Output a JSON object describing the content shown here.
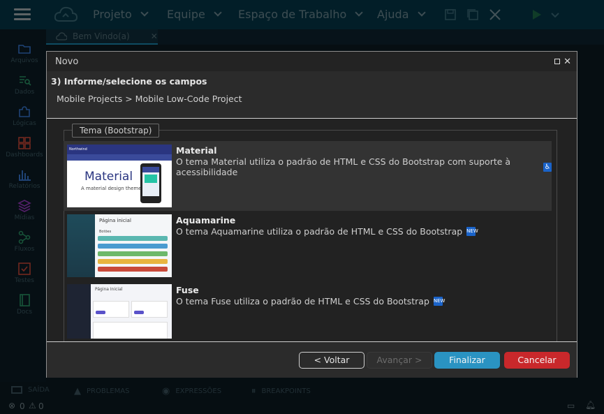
{
  "app": {
    "menu": [
      "Projeto",
      "Equipe",
      "Espaço de Trabalho",
      "Ajuda"
    ],
    "tab_label": "Bem Vindo(a)"
  },
  "sidebar": [
    {
      "label": "Arquivos",
      "icon": "folder-icon",
      "color": "#3a7bd5"
    },
    {
      "label": "Dados",
      "icon": "database-search-icon",
      "color": "#2c9c6a"
    },
    {
      "label": "Lógicas",
      "icon": "puzzle-icon",
      "color": "#3a7bd5"
    },
    {
      "label": "Dashboards",
      "icon": "dashboard-grid-icon",
      "color": "#d04a3a"
    },
    {
      "label": "Relatórios",
      "icon": "bar-chart-icon",
      "color": "#3a7bd5"
    },
    {
      "label": "Mídias",
      "icon": "layers-icon",
      "color": "#9b3ac2"
    },
    {
      "label": "Fluxos",
      "icon": "flow-icon",
      "color": "#2c9c6a"
    },
    {
      "label": "Testes",
      "icon": "checklist-icon",
      "color": "#d04a3a"
    },
    {
      "label": "Docs",
      "icon": "book-icon",
      "color": "#2c9c6a"
    }
  ],
  "bottom": {
    "tabs": [
      "SAÍDA",
      "PROBLEMAS",
      "EXPRESSÕES",
      "BREAKPOINTS"
    ],
    "errors": "0",
    "warnings": "0"
  },
  "dialog": {
    "title": "Novo",
    "step": "3) Informe/selecione os campos",
    "breadcrumb": "Mobile Projects > Mobile Low-Code Project",
    "fieldset_legend": "Tema (Bootstrap)",
    "themes": [
      {
        "name": "Material",
        "description": "O tema Material utiliza o padrão de HTML e CSS do Bootstrap com suporte à acessibilidade",
        "badge": "accessibility-icon",
        "thumb_title": "Material",
        "thumb_sub": "A material design theme",
        "thumb_brand": "Northwind"
      },
      {
        "name": "Aquamarine",
        "description": "O tema Aquamarine utiliza o padrão de HTML e CSS do Bootstrap",
        "badge": "NEW",
        "thumb_title": "Página inicial",
        "thumb_sub": "Botões"
      },
      {
        "name": "Fuse",
        "description": "O tema Fuse utiliza o padrão de HTML e CSS do Bootstrap",
        "badge": "NEW",
        "thumb_title": "Página Inicial"
      }
    ],
    "buttons": {
      "back": "< Voltar",
      "next": "Avançar >",
      "finish": "Finalizar",
      "cancel": "Cancelar"
    }
  }
}
